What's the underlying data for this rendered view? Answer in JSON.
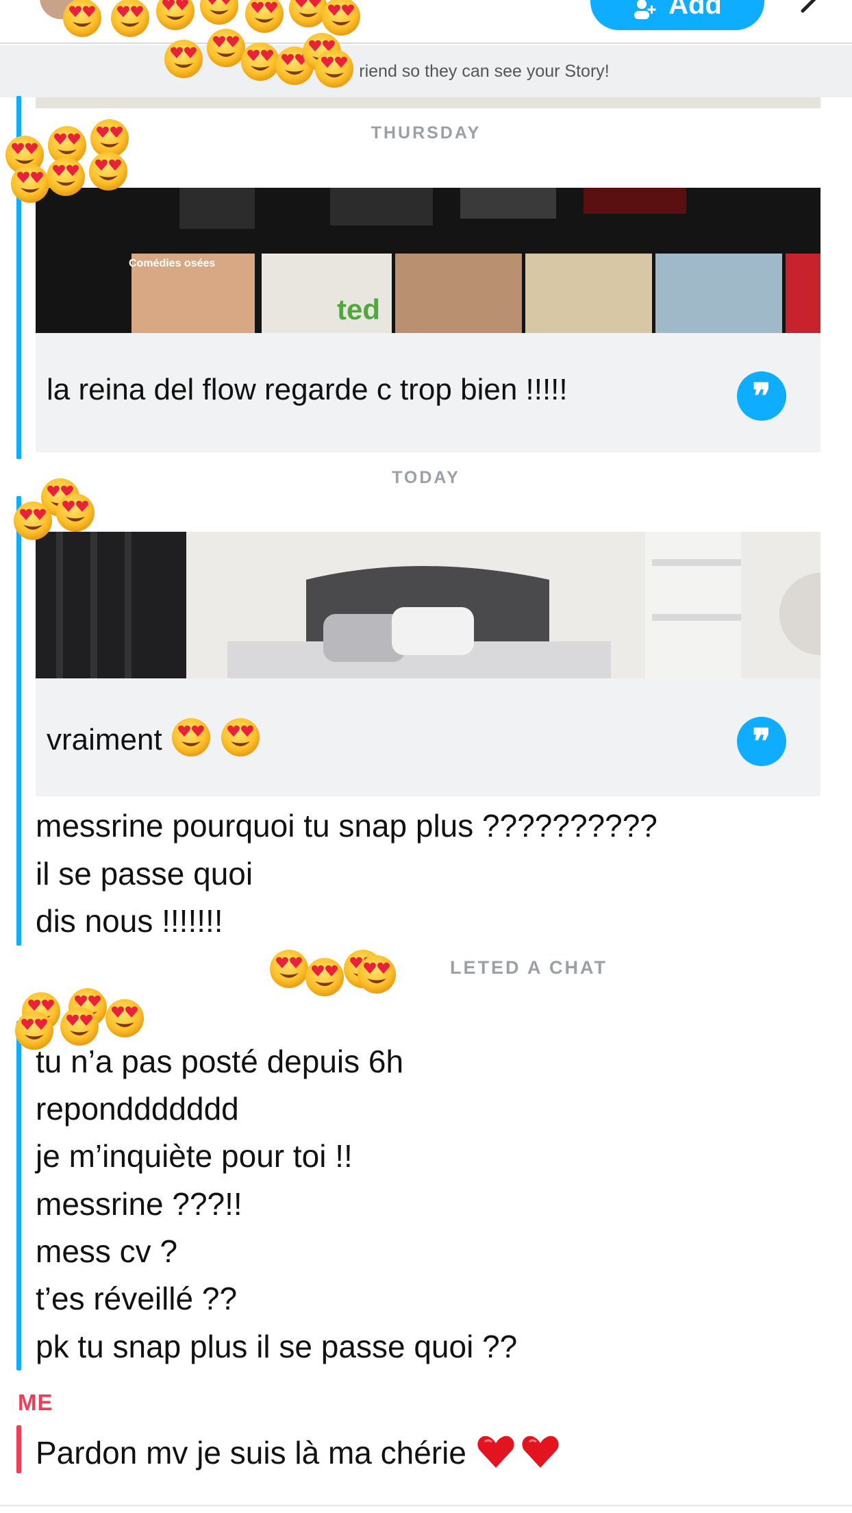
{
  "header": {
    "add_label": "Add",
    "banner_text": "riend so they can see your Story!"
  },
  "colors": {
    "accent": "#0eadff",
    "me_red": "#f23c57",
    "muted": "#9aa0a6"
  },
  "chat": {
    "day1": "THURSDAY",
    "reply1": {
      "caption": "la reina del flow regarde c trop bien !!!!!",
      "icon": "quote-icon"
    },
    "day2": "TODAY",
    "reply2": {
      "caption": "vraiment",
      "icon": "quote-icon"
    },
    "messages_a": [
      "messrine pourquoi tu snap plus ??????????",
      "il se passe quoi",
      "dis nous !!!!!!!"
    ],
    "deleted_text": "LETED A CHAT",
    "messages_b": [
      "tu n’a pas posté depuis 6h",
      "reponddddddd",
      "je m’inquiète pour toi !!",
      "messrine ???!!",
      "mess cv ?",
      "t’es réveillé ??",
      "pk tu snap plus il se passe quoi ??"
    ],
    "me_label": "ME",
    "my_message": "Pardon mv je suis là ma chérie"
  }
}
